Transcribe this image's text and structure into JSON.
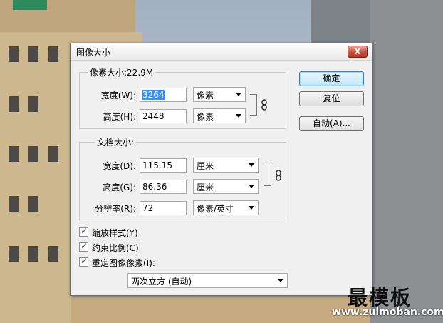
{
  "dialog": {
    "title": "图像大小",
    "close_label": "X",
    "pixel_dimensions": {
      "label": "像素大小:22.9M",
      "width_label": "宽度(W):",
      "width_value": "3264",
      "width_unit": "像素",
      "height_label": "高度(H):",
      "height_value": "2448",
      "height_unit": "像素"
    },
    "document_size": {
      "label": "文档大小:",
      "width_label": "宽度(D):",
      "width_value": "115.15",
      "width_unit": "厘米",
      "height_label": "高度(G):",
      "height_value": "86.36",
      "height_unit": "厘米",
      "resolution_label": "分辨率(R):",
      "resolution_value": "72",
      "resolution_unit": "像素/英寸"
    },
    "buttons": {
      "ok": "确定",
      "reset": "复位",
      "auto": "自动(A)..."
    },
    "options": {
      "scale_styles": "缩放样式(Y)",
      "constrain_proportions": "约束比例(C)",
      "resample_image": "重定图像像素(I):",
      "resample_method": "两次立方 (自动)"
    }
  },
  "watermark": {
    "text": "最模板",
    "url": "www.zuimoban.com"
  }
}
